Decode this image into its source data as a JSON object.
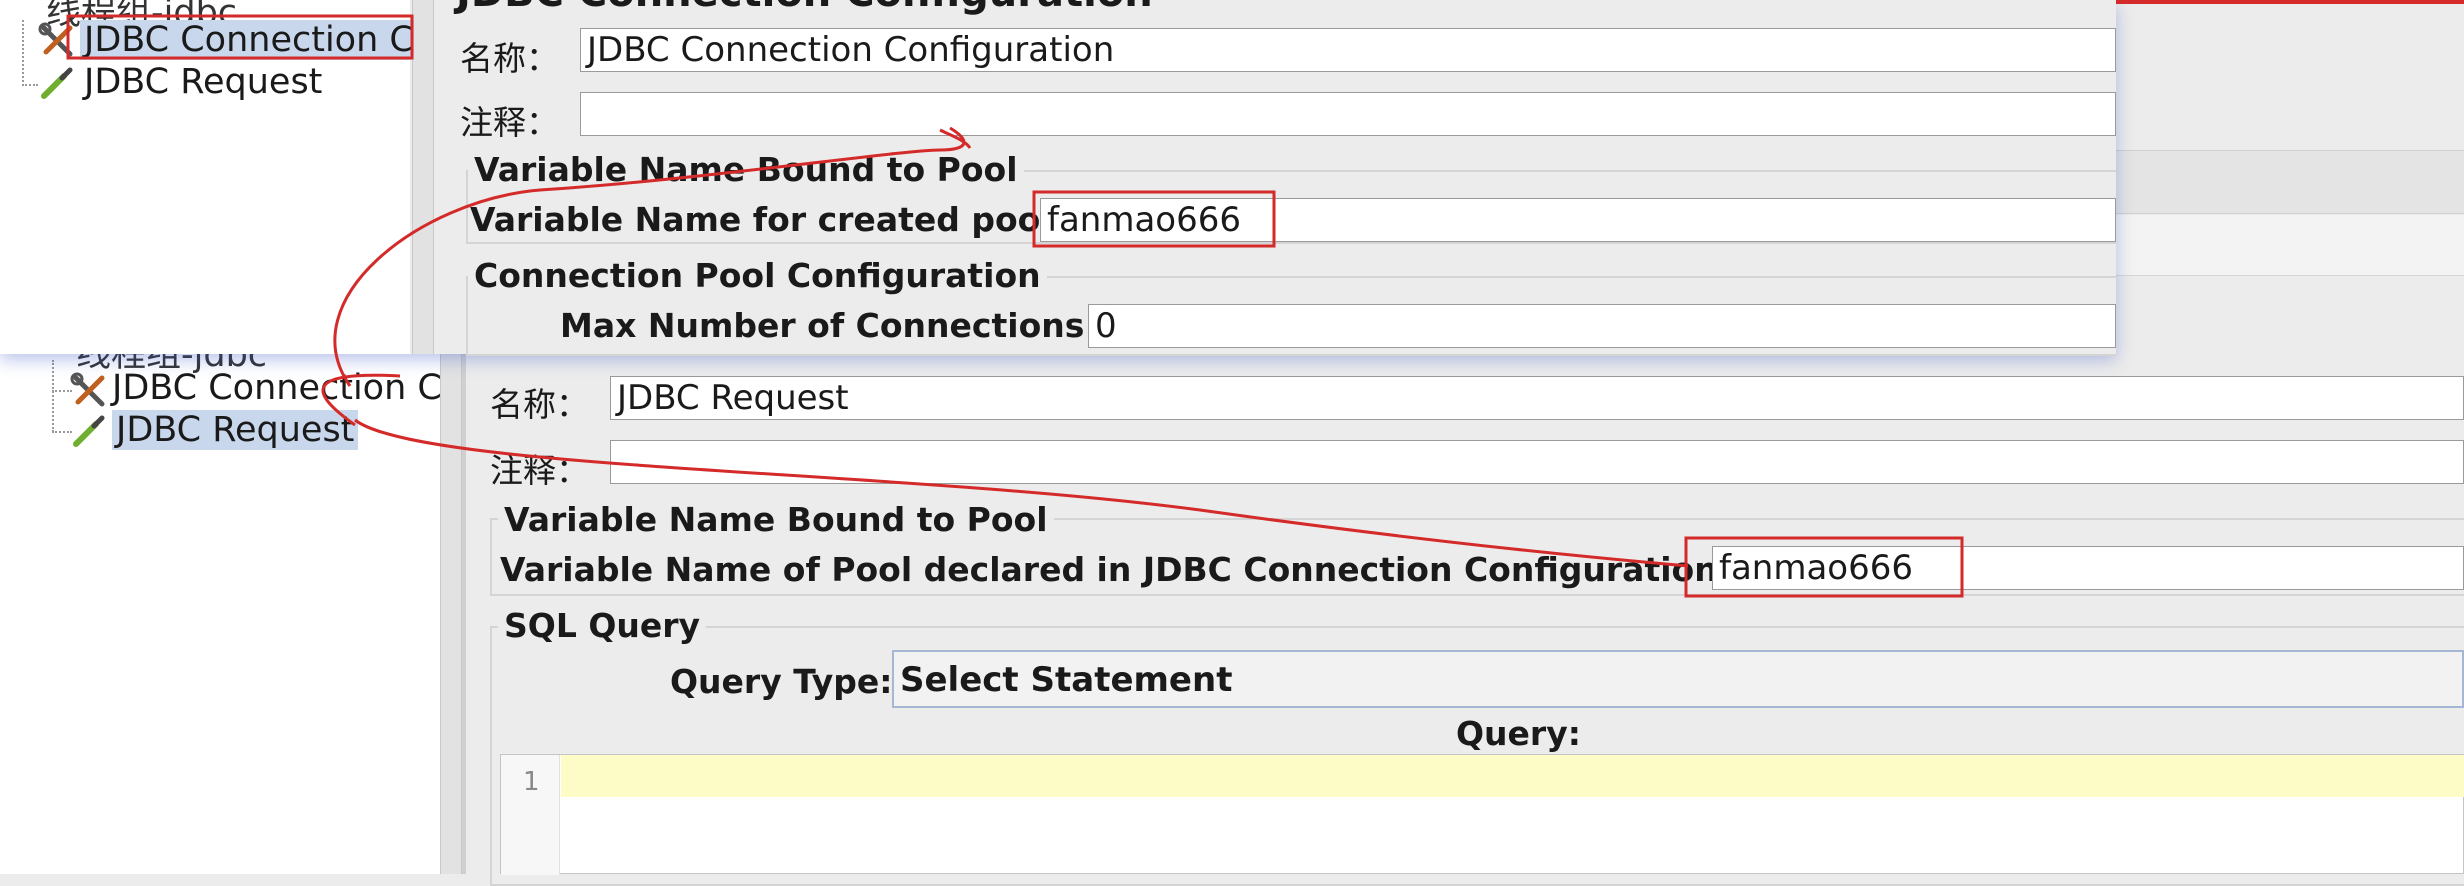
{
  "overlay": {
    "tree": {
      "parent_label": "线程组-jdbc",
      "items": [
        {
          "label": "JDBC Connection C",
          "selected": true
        },
        {
          "label": "JDBC Request",
          "selected": false
        }
      ]
    },
    "form": {
      "header_title": "JDBC Connection Configuration",
      "name_label": "名称：",
      "name_value": "JDBC Connection Configuration",
      "comment_label": "注释：",
      "comment_value": "",
      "section1_title": "Variable Name Bound to Pool",
      "pool_var_label": "Variable Name for created pool:",
      "pool_var_value": "fanmao666",
      "section2_title": "Connection Pool Configuration",
      "max_conn_label": "Max Number of Connections:",
      "max_conn_value": "0"
    }
  },
  "main": {
    "tree": {
      "parent_label": "线程组-jdbc",
      "items": [
        {
          "label": "JDBC Connection C",
          "selected": false
        },
        {
          "label": "JDBC Request",
          "selected": true
        }
      ]
    },
    "form": {
      "name_label": "名称：",
      "name_value": "JDBC Request",
      "comment_label": "注释：",
      "comment_value": "",
      "section1_title": "Variable Name Bound to Pool",
      "pool_var_label": "Variable Name of Pool declared in JDBC Connection Configuration:",
      "pool_var_value": "fanmao666",
      "section2_title": "SQL Query",
      "query_type_label": "Query Type:",
      "query_type_value": "Select Statement",
      "query_label": "Query:",
      "editor_line_number": "1"
    }
  },
  "colors": {
    "annotation_red": "#d42a2a",
    "selection_blue": "#c9d7ec",
    "editor_highlight": "#fdfbc6"
  }
}
